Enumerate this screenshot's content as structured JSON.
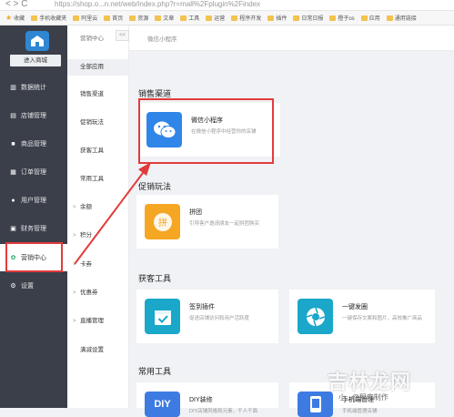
{
  "browser": {
    "url": "https://shop.o...n.net/web/index.php?r=mall%2Fplugin%2Findex"
  },
  "bookmarks": [
    "收藏",
    "手机收藏夹",
    "阿里云",
    "首页",
    "资源",
    "文章",
    "工具",
    "运营",
    "程序开发",
    "插件",
    "日常日报",
    "橙子os",
    "应用",
    "通用链接"
  ],
  "sidebar": {
    "enter_shop": "进入商城",
    "items": [
      {
        "label": "数据统计",
        "icon": "chart-icon"
      },
      {
        "label": "店铺管理",
        "icon": "shop-icon"
      },
      {
        "label": "商品管理",
        "icon": "goods-icon"
      },
      {
        "label": "订单管理",
        "icon": "order-icon"
      },
      {
        "label": "用户管理",
        "icon": "user-icon"
      },
      {
        "label": "财务管理",
        "icon": "finance-icon"
      },
      {
        "label": "营销中心",
        "icon": "marketing-icon"
      },
      {
        "label": "设置",
        "icon": "settings-icon"
      }
    ]
  },
  "subnav": {
    "title": "营销中心",
    "collapse": "<<",
    "items": [
      {
        "label": "全部应用",
        "chevron": false
      },
      {
        "label": "销售渠道",
        "chevron": false
      },
      {
        "label": "促销玩法",
        "chevron": false
      },
      {
        "label": "获客工具",
        "chevron": false
      },
      {
        "label": "常用工具",
        "chevron": false
      },
      {
        "label": "余额",
        "chevron": true
      },
      {
        "label": "积分",
        "chevron": true
      },
      {
        "label": "卡券",
        "chevron": true
      },
      {
        "label": "优惠券",
        "chevron": true
      },
      {
        "label": "直播管理",
        "chevron": true
      },
      {
        "label": "满减设置",
        "chevron": false
      }
    ]
  },
  "topbar": {
    "breadcrumb": "微信小程序"
  },
  "sections": {
    "sales": {
      "title": "销售渠道",
      "cards": [
        {
          "name": "微信小程序",
          "desc": "在微信小程序中经营你的店铺",
          "icon": "wechat-icon",
          "color": "#2f86e8"
        }
      ]
    },
    "promo": {
      "title": "促销玩法",
      "cards": [
        {
          "name": "拼团",
          "desc": "引导客户邀请朋友一起拼团购买",
          "icon": "pintuan-icon",
          "color": "#f5a623"
        }
      ]
    },
    "acquire": {
      "title": "获客工具",
      "cards": [
        {
          "name": "签到插件",
          "desc": "促进店铺访问和用户活跃度",
          "icon": "calendar-check-icon",
          "color": "#1aa7c9"
        },
        {
          "name": "一键发圈",
          "desc": "一键保存文案和图片，高效推广商品",
          "icon": "aperture-icon",
          "color": "#1aa7c9"
        }
      ]
    },
    "tools": {
      "title": "常用工具",
      "cards": [
        {
          "name": "DIY装修",
          "desc": "DIY店铺风格和元素，千人千面",
          "icon": "diy-icon",
          "color": "#3d7be3",
          "icon_text": "DIY"
        },
        {
          "name": "手机端管理",
          "desc": "手机端管理店铺",
          "icon": "phone-icon",
          "color": "#3d7be3"
        }
      ]
    }
  },
  "watermark": {
    "main": "吉林龙网",
    "sub": "小...@程序制作"
  },
  "colors": {
    "sidebar_bg": "#3a3f4a",
    "highlight_red": "#e23b3b",
    "wechat_blue": "#2f86e8",
    "orange": "#f5a623",
    "teal": "#1aa7c9"
  }
}
